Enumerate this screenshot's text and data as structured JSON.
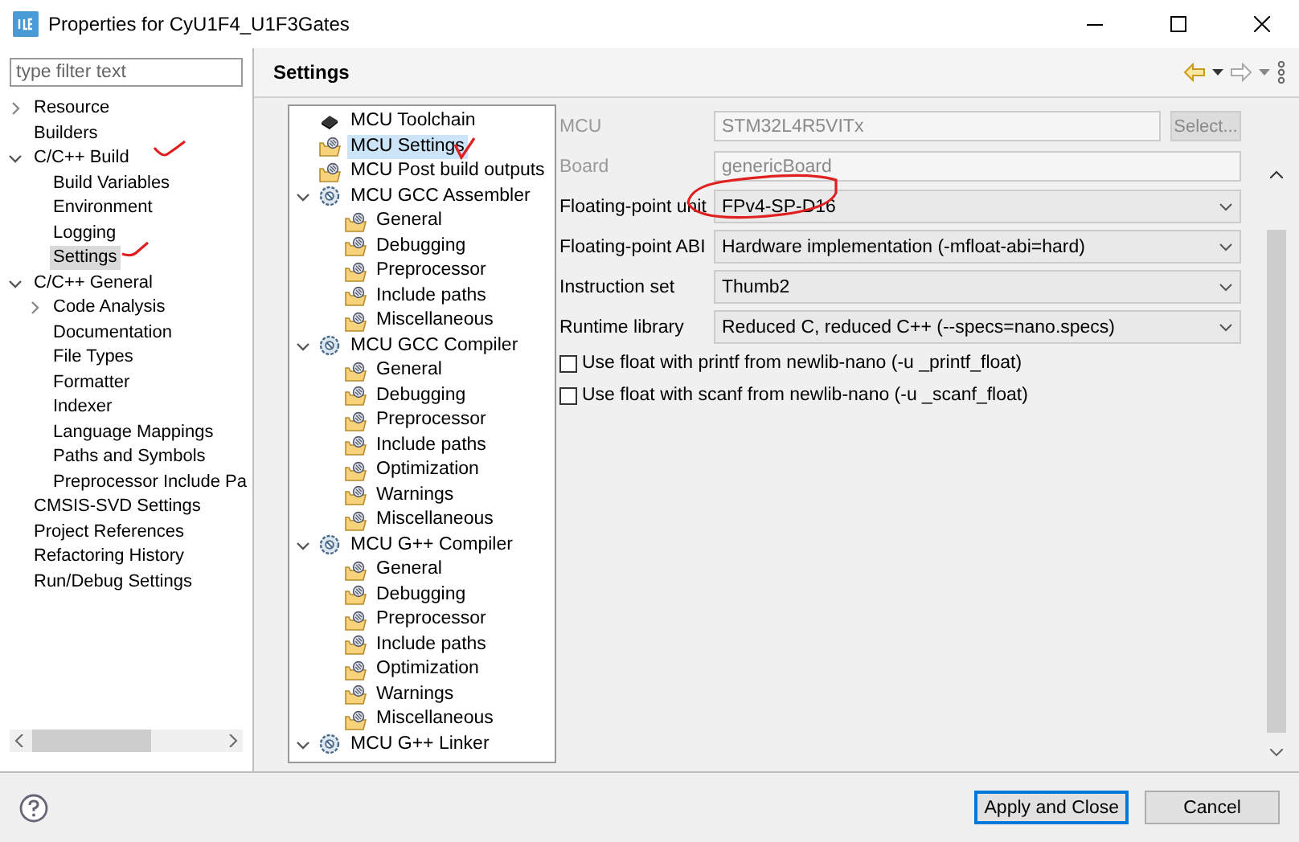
{
  "window": {
    "title": "Properties for CyU1F4_U1F3Gates"
  },
  "filter": {
    "placeholder": "type filter text"
  },
  "nav_tree": [
    {
      "label": "Resource",
      "selected": false,
      "expanded": false
    },
    {
      "label": "Builders",
      "selected": false
    },
    {
      "label": "C/C++ Build",
      "selected": false,
      "expanded": true,
      "children": [
        {
          "label": "Build Variables",
          "selected": false
        },
        {
          "label": "Environment",
          "selected": false
        },
        {
          "label": "Logging",
          "selected": false
        },
        {
          "label": "Settings",
          "selected": true
        }
      ]
    },
    {
      "label": "C/C++ General",
      "selected": false,
      "expanded": true,
      "children": [
        {
          "label": "Code Analysis",
          "selected": false,
          "expanded": false
        },
        {
          "label": "Documentation",
          "selected": false
        },
        {
          "label": "File Types",
          "selected": false
        },
        {
          "label": "Formatter",
          "selected": false
        },
        {
          "label": "Indexer",
          "selected": false
        },
        {
          "label": "Language Mappings",
          "selected": false
        },
        {
          "label": "Paths and Symbols",
          "selected": false
        },
        {
          "label": "Preprocessor Include Pa",
          "selected": false
        }
      ]
    },
    {
      "label": "CMSIS-SVD Settings",
      "selected": false
    },
    {
      "label": "Project References",
      "selected": false
    },
    {
      "label": "Refactoring History",
      "selected": false
    },
    {
      "label": "Run/Debug Settings",
      "selected": false
    }
  ],
  "page": {
    "title": "Settings"
  },
  "tool_tree": [
    {
      "label": "MCU Toolchain",
      "kind": "chip",
      "selected": false
    },
    {
      "label": "MCU Settings",
      "kind": "folder",
      "selected": true
    },
    {
      "label": "MCU Post build outputs",
      "kind": "folder",
      "selected": false
    },
    {
      "label": "MCU GCC Assembler",
      "kind": "tool",
      "selected": false,
      "expanded": true,
      "children": [
        {
          "label": "General",
          "kind": "folder",
          "selected": false
        },
        {
          "label": "Debugging",
          "kind": "folder",
          "selected": false
        },
        {
          "label": "Preprocessor",
          "kind": "folder",
          "selected": false
        },
        {
          "label": "Include paths",
          "kind": "folder",
          "selected": false
        },
        {
          "label": "Miscellaneous",
          "kind": "folder",
          "selected": false
        }
      ]
    },
    {
      "label": "MCU GCC Compiler",
      "kind": "tool",
      "selected": false,
      "expanded": true,
      "children": [
        {
          "label": "General",
          "kind": "folder",
          "selected": false
        },
        {
          "label": "Debugging",
          "kind": "folder",
          "selected": false
        },
        {
          "label": "Preprocessor",
          "kind": "folder",
          "selected": false
        },
        {
          "label": "Include paths",
          "kind": "folder",
          "selected": false
        },
        {
          "label": "Optimization",
          "kind": "folder",
          "selected": false
        },
        {
          "label": "Warnings",
          "kind": "folder",
          "selected": false
        },
        {
          "label": "Miscellaneous",
          "kind": "folder",
          "selected": false
        }
      ]
    },
    {
      "label": "MCU G++ Compiler",
      "kind": "tool",
      "selected": false,
      "expanded": true,
      "children": [
        {
          "label": "General",
          "kind": "folder",
          "selected": false
        },
        {
          "label": "Debugging",
          "kind": "folder",
          "selected": false
        },
        {
          "label": "Preprocessor",
          "kind": "folder",
          "selected": false
        },
        {
          "label": "Include paths",
          "kind": "folder",
          "selected": false
        },
        {
          "label": "Optimization",
          "kind": "folder",
          "selected": false
        },
        {
          "label": "Warnings",
          "kind": "folder",
          "selected": false
        },
        {
          "label": "Miscellaneous",
          "kind": "folder",
          "selected": false
        }
      ]
    },
    {
      "label": "MCU G++ Linker",
      "kind": "tool",
      "selected": false,
      "expanded": true
    }
  ],
  "form": [
    {
      "kind": "text",
      "label": "MCU",
      "value": "STM32L4R5VITx",
      "disabled": true,
      "button": "Select..."
    },
    {
      "kind": "text",
      "label": "Board",
      "value": "genericBoard",
      "disabled": true
    },
    {
      "kind": "select",
      "label": "Floating-point unit",
      "value": "FPv4-SP-D16",
      "disabled": false
    },
    {
      "kind": "select",
      "label": "Floating-point ABI",
      "value": "Hardware implementation (-mfloat-abi=hard)",
      "disabled": false
    },
    {
      "kind": "select",
      "label": "Instruction set",
      "value": "Thumb2",
      "disabled": false
    },
    {
      "kind": "select",
      "label": "Runtime library",
      "value": "Reduced C, reduced C++ (--specs=nano.specs)",
      "disabled": false
    },
    {
      "kind": "check",
      "label": "Use float with printf from newlib-nano (-u _printf_float)",
      "checked": false
    },
    {
      "kind": "check",
      "label": "Use float with scanf from newlib-nano (-u _scanf_float)",
      "checked": false
    }
  ],
  "buttons": [
    {
      "label": "Apply and Close",
      "default": true
    },
    {
      "label": "Cancel",
      "default": false
    }
  ]
}
